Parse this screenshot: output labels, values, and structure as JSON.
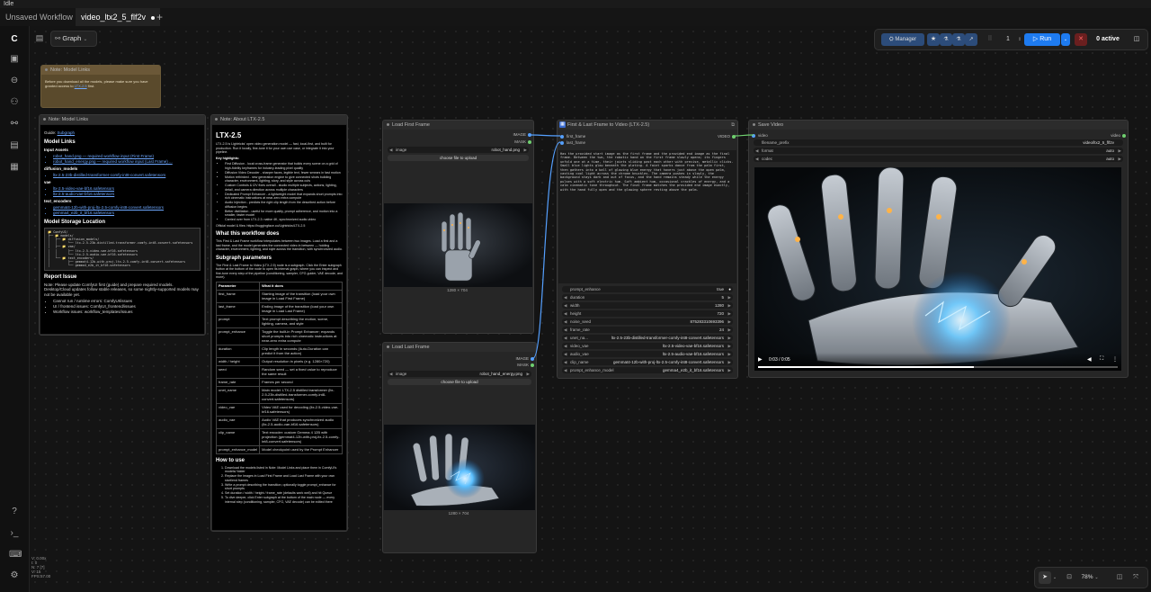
{
  "titlebar": {
    "app": "Idle"
  },
  "tabs": [
    {
      "label": "Unsaved Workflow"
    },
    {
      "label": "video_ltx2_5_flf2v"
    }
  ],
  "graph_menu": {
    "label": "Graph"
  },
  "toolbar": {
    "manager": "Manager",
    "queue_count": "1",
    "run": "Run",
    "active": "0 active"
  },
  "zoom": {
    "percent": "78%"
  },
  "stats": [
    "V: 0.00x",
    "I: 0",
    "N: 7 [7]",
    "V: 15",
    "FPS:57.00"
  ],
  "note_top": {
    "title": "Note: Model Links",
    "text": "Before you download all the models, please make sure you have granted access to",
    "link": "LTX-2.5",
    "tail": "first."
  },
  "note_links": {
    "title": "Note: Model Links",
    "guide_label": "Guide:",
    "guide_link": "Subgraph",
    "h_models": "Model Links",
    "input_assets": "Input Assets",
    "inputs": [
      "robot_hand.png — required workflow input (First Frame)",
      "robot_hand_energy.png — required workflow input (Last Frame) ..."
    ],
    "diffusion_label": "diffusion_models",
    "diffusion": [
      "ltx-2.5-23b-distilled-transformer-comfy-int8-convert.safetensors"
    ],
    "vae_label": "vae",
    "vae": [
      "ltx-2.5-video-vae-bf16.safetensors",
      "ltx-2.5-audio-vae-bf16.safetensors"
    ],
    "te_label": "text_encoders",
    "te": [
      "gemmat4-12b-with-proj-ltx-2.5-comfy-int8-convert.safetensors",
      "gemma4_e2b_it_bf16.safetensors"
    ],
    "h_storage": "Model Storage Location",
    "tree": "📁 ComfyUI/\n├── 📁 models/\n│   ├── 📁 diffusion_models/\n│   │      └── ltx-2.5-23b-distilled-transformer-comfy-int8-convert.safetensors\n│   ├── 📁 vae/\n│   │      ├── ltx-2.5-video-vae-bf16.safetensors\n│   │      └── ltx-2.5-audio-vae-bf16.safetensors\n│   └── 📁 text_encoders/\n│          ├── gemmat4-12b-with-proj-ltx-2.5-comfy-int8-convert.safetensors\n│          └── gemma4_e2b_it_bf16.safetensors",
    "h_report": "Report Issue",
    "report_text": "Note: Please update ComfyUI first (guide) and prepare required models. Desktop/Cloud updates follow stable releases, so some nightly-supported models may not be available yet.",
    "report_items": [
      "Cannot run / runtime errors: ComfyUI/issues",
      "UI / frontend issues: ComfyUI_frontend/issues",
      "Workflow issues: workflow_templates/issues"
    ]
  },
  "note_about": {
    "title": "Note: About LTX-2.5",
    "h1": "LTX-2.5",
    "intro": "LTX-2.5 is Lightricks' open video generation model — fast, local-first, and built for production. Run it locally, fine-tune it for your own use case, or integrate it into your pipeline.",
    "key_label": "Key highlights:",
    "highlights": [
      "First Diffusion - local cross-frame generator that builds every scene on a grid of high-fidelity keyframes for industry-leading pixel quality",
      "Diffusion Video Decoder - sharper faces, legible text, fewer smears in fast motion",
      "Motion rethinked - new generation engine to give connected shots building character, environment, lighting, story, and style across cuts",
      "Custom Controls & I2V fixes overall - studio multiple subjects, actions, lighting, detail, and camera direction across multiple characters",
      "Dedicated Prompt Enhancer - a lightweight model that expands short prompts into rich cinematic instructions at near-zero extra compute",
      "Audio Injection - predicts the right clip length from the described action before diffusion begins",
      "Better distillation - useful for more quality, prompt adherence, and motion into a smaller, faster model",
      "Carried over from LTX-2.3: native 4K, synchronized audio-video"
    ],
    "official": "Official model & files: https://huggingface.co/Lightricks/LTX-2.5",
    "h_what": "What this workflow does",
    "what_text": "This First & Last Frame workflow interpolates between two images. Load a first and a last frame, and the model generates the connected video in between — holding character, environment, lighting, and style across the transition, with synchronized audio.",
    "h_sub": "Subgraph parameters",
    "sub_text": "The First & Last Frame to Video (LTX-2.5) node is a subgraph. Click the Enter subgraph button at the bottom of the node to open its internal graph, where you can inspect and fine-tune every step of the pipeline (conditioning, sampler, CFG guider, VAE decode, and more).",
    "table_head": [
      "Parameter",
      "What it does"
    ],
    "table": [
      [
        "first_frame",
        "Starting image of the transition (load your own image in Load First Frame)"
      ],
      [
        "last_frame",
        "Ending image of the transition (load your own image in Load Last Frame)"
      ],
      [
        "prompt",
        "Text prompt describing the motion, scene, lighting, camera, and style"
      ],
      [
        "prompt_enhance",
        "Toggle the built-in Prompt Enhancer; expands short prompts into rich cinematic instructions at near-zero extra compute"
      ],
      [
        "duration",
        "Clip length in seconds (Auto-Duration can predict it from the action)"
      ],
      [
        "width / height",
        "Output resolution in pixels (e.g. 1280×720)"
      ],
      [
        "seed",
        "Random seed — set a fixed value to reproduce the same result"
      ],
      [
        "frame_rate",
        "Frames per second"
      ],
      [
        "unet_name",
        "Main model: LTX-2.5 distilled transformer (ltx-2.5-23b-distilled-transformer-comfy-int8-convert.safetensors)"
      ],
      [
        "video_vae",
        "Video VAE used for decoding (ltx-2.5-video-vae-bf16.safetensors)"
      ],
      [
        "audio_vae",
        "Audio VAE that produces synchronized audio (ltx-2.5-audio-vae-bf16.safetensors)"
      ],
      [
        "clip_name",
        "Text encoder: custom Gemma 4 12B with projection (gemmat4-12b-with-proj-ltx-2.5-comfy-int8-convert.safetensors)"
      ],
      [
        "prompt_enhance_model",
        "Model checkpoint used by the Prompt Enhancer"
      ]
    ],
    "h_how": "How to use",
    "how": [
      "Download the models listed in Note: Model Links and place them in ComfyUI's models/ folder",
      "Replace the images in Load First Frame and Load Last Frame with your own start/end frames",
      "Write a prompt describing the transition; optionally toggle prompt_enhance for short prompts",
      "Set duration / width / height / frame_rate (defaults work well) and hit Queue",
      "To dive deeper, click Enter subgraph at the bottom of the main node — every internal step (conditioning, sampler, CFG, VAE decode) can be edited there"
    ]
  },
  "load_first": {
    "title": "Load First Frame",
    "out_image": "IMAGE",
    "out_mask": "MASK",
    "image_label": "image",
    "image_value": "robot_hand.png",
    "upload": "choose file to upload",
    "dims": "1280 × 704"
  },
  "load_last": {
    "title": "Load Last Frame",
    "out_image": "IMAGE",
    "out_mask": "MASK",
    "image_label": "image",
    "image_value": "robot_hand_energy.png",
    "upload": "choose file to upload",
    "dims": "1280 × 704"
  },
  "flf": {
    "title": "First & Last Frame to Video (LTX-2.5)",
    "in_first": "first_frame",
    "in_last": "last_frame",
    "out_video": "VIDEO",
    "prompt": "Has the provided start image as the first frame and the provided end image as the final frame. Between the two, the robotic hand on the first frame slowly opens; its fingers unfold one at a time, their joints sliding past each other with precise, metallic clicks. Small blue lights glow beneath the plating. A faint sparks dance from the palm first, then gathers into a ball of glowing blue energy that hovers just above the open palm, casting cool light across the chrome knuckles. The camera pushes in slowly, the background stays dark and out of focus, and the hand remains steady while the energy pulses with a soft electric hum. Soft ambient hum, occasional crackles of energy, and a calm cinematic tone throughout. The final frame matches the provided end image exactly, with the hand fully open and the glowing sphere resting above the palm.",
    "widgets": [
      {
        "label": "prompt_enhance",
        "value": "true"
      },
      {
        "label": "duration",
        "value": "5"
      },
      {
        "label": "width",
        "value": "1280"
      },
      {
        "label": "height",
        "value": "720"
      },
      {
        "label": "noise_seed",
        "value": "875283310693396"
      },
      {
        "label": "frame_rate",
        "value": "24"
      },
      {
        "label": "unet_na...",
        "value": "ltx-2.5-23b-distilled-transformer-comfy-int8-convert.safetensors"
      },
      {
        "label": "video_vae",
        "value": "ltx-2.5-video-vae-bf16.safetensors"
      },
      {
        "label": "audio_vae",
        "value": "ltx-2.5-audio-vae-bf16.safetensors"
      },
      {
        "label": "clip_name",
        "value": "gemmat4-12b-with-proj-ltx-2.5-comfy-int8-convert.safetensors"
      },
      {
        "label": "prompt_enhance_model",
        "value": "gemma4_e2b_it_bf16.safetensors"
      }
    ]
  },
  "save": {
    "title": "Save Video",
    "in_video": "video",
    "video_label": "video",
    "widgets": [
      {
        "label": "filename_prefix",
        "value": "video/ltx2_5_flf2v"
      },
      {
        "label": "format",
        "value": "auto"
      },
      {
        "label": "codec",
        "value": "auto"
      }
    ],
    "time": "0:03 / 0:05",
    "progress": 0.6
  },
  "colors": {
    "accent": "#1e7bf0",
    "link": "#55a0ff",
    "note_top": "#5a4a2c"
  }
}
